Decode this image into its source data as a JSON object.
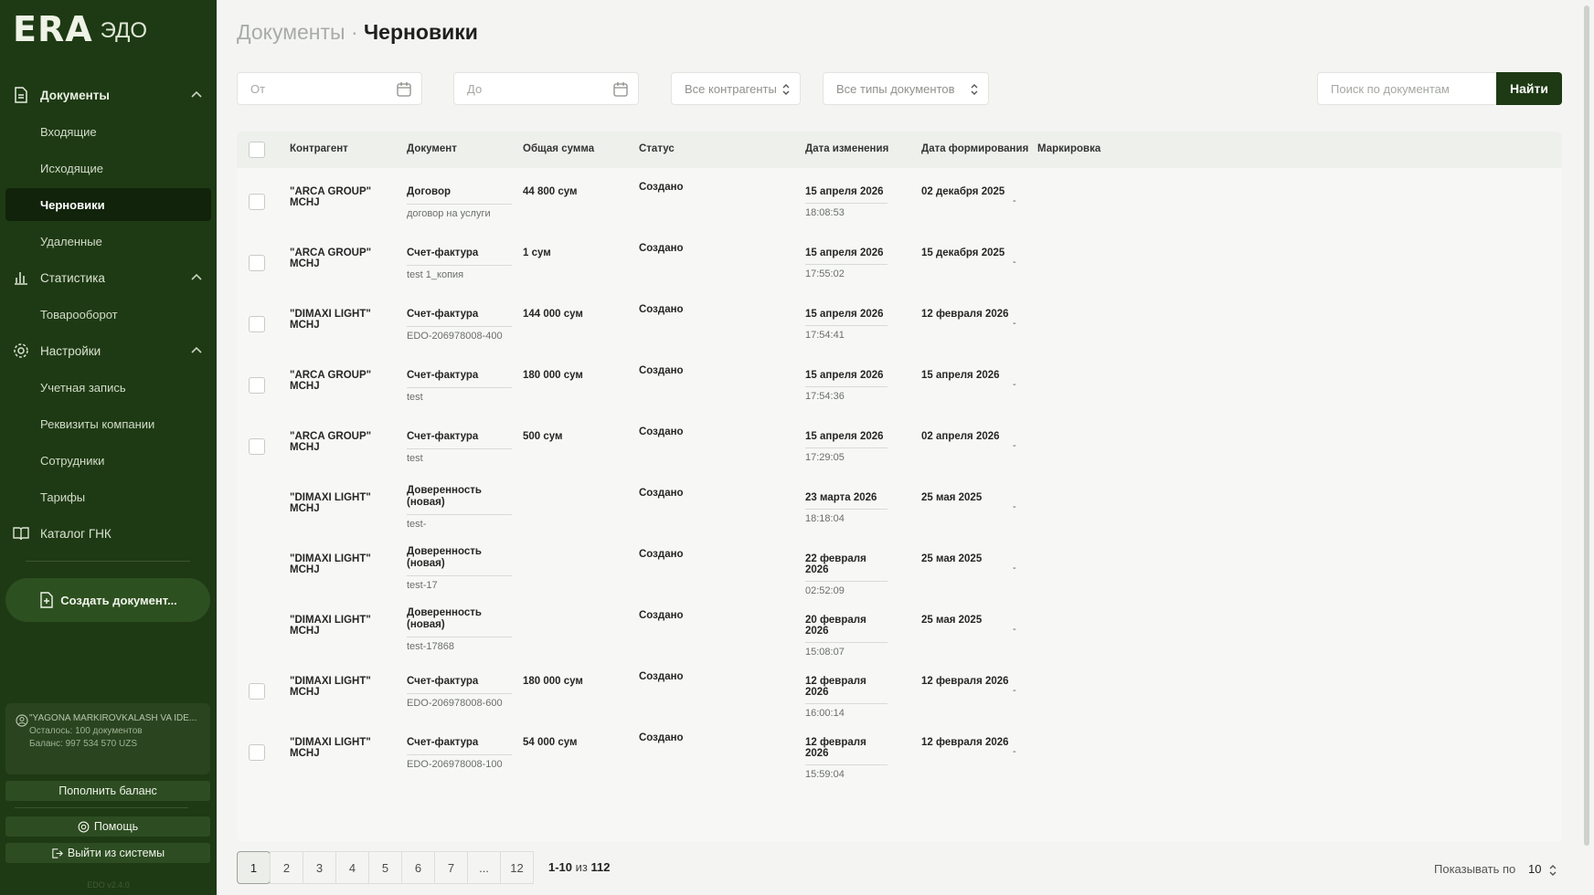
{
  "brand": {
    "logo": "ERA",
    "product": "ЭДО"
  },
  "sidebar": {
    "groups": [
      {
        "label": "Документы",
        "icon": "document-icon",
        "items": [
          "Входящие",
          "Исходящие",
          "Черновики",
          "Удаленные"
        ]
      },
      {
        "label": "Статистика",
        "icon": "bar-chart-icon",
        "items": [
          "Товарооборот"
        ]
      },
      {
        "label": "Настройки",
        "icon": "gear-icon",
        "items": [
          "Учетная запись",
          "Реквизиты компании",
          "Сотрудники",
          "Тарифы"
        ]
      }
    ],
    "catalog": "Каталог ГНК",
    "active_item": "Черновики",
    "create_button": "Создать документ...",
    "account": {
      "company": "\"YAGONA MARKIROVKALASH VA IDE...",
      "remaining": "Осталось: 100 документов",
      "balance": "Баланс: 997 534 570 UZS"
    },
    "topup_button": "Пополнить баланс",
    "help_button": "Помощь",
    "logout_button": "Выйти из системы",
    "version": "EDO v2.4.0"
  },
  "page": {
    "section": "Документы",
    "separator": "·",
    "title": "Черновики"
  },
  "filters": {
    "from_placeholder": "От",
    "to_placeholder": "До",
    "counterparties": "Все контрагенты",
    "doc_types": "Все типы документов",
    "search_placeholder": "Поиск по документам",
    "search_button": "Найти"
  },
  "table": {
    "columns": [
      "Контрагент",
      "Документ",
      "Общая сумма",
      "Статус",
      "Дата изменения",
      "Дата формирования",
      "Маркировка"
    ],
    "rows": [
      {
        "counterparty": "\"ARCA GROUP\" MCHJ",
        "doc_type": "Договор",
        "doc_name": "договор на услуги",
        "amount": "44 800 сум",
        "status": "Создано",
        "changed_date": "15 апреля 2026",
        "changed_time": "18:08:53",
        "formed": "02 декабря 2025",
        "marking": "-",
        "checkbox": true
      },
      {
        "counterparty": "\"ARCA GROUP\" MCHJ",
        "doc_type": "Счет-фактура",
        "doc_name": "test 1_копия",
        "amount": "1 сум",
        "status": "Создано",
        "changed_date": "15 апреля 2026",
        "changed_time": "17:55:02",
        "formed": "15 декабря 2025",
        "marking": "-",
        "checkbox": true
      },
      {
        "counterparty": "\"DIMAXI LIGHT\" MCHJ",
        "doc_type": "Счет-фактура",
        "doc_name": "EDO-206978008-400",
        "amount": "144 000 сум",
        "status": "Создано",
        "changed_date": "15 апреля 2026",
        "changed_time": "17:54:41",
        "formed": "12 февраля 2026",
        "marking": "-",
        "checkbox": true
      },
      {
        "counterparty": "\"ARCA GROUP\" MCHJ",
        "doc_type": "Счет-фактура",
        "doc_name": "test",
        "amount": "180 000 сум",
        "status": "Создано",
        "changed_date": "15 апреля 2026",
        "changed_time": "17:54:36",
        "formed": "15 апреля 2026",
        "marking": "-",
        "checkbox": true
      },
      {
        "counterparty": "\"ARCA GROUP\" MCHJ",
        "doc_type": "Счет-фактура",
        "doc_name": "test",
        "amount": "500 сум",
        "status": "Создано",
        "changed_date": "15 апреля 2026",
        "changed_time": "17:29:05",
        "formed": "02 апреля 2026",
        "marking": "-",
        "checkbox": true
      },
      {
        "counterparty": "\"DIMAXI LIGHT\" MCHJ",
        "doc_type": "Доверенность (новая)",
        "doc_name": "test-",
        "amount": "",
        "status": "Создано",
        "changed_date": "23 марта 2026",
        "changed_time": "18:18:04",
        "formed": "25 мая 2025",
        "marking": "-",
        "checkbox": false
      },
      {
        "counterparty": "\"DIMAXI LIGHT\" MCHJ",
        "doc_type": "Доверенность (новая)",
        "doc_name": "test-17",
        "amount": "",
        "status": "Создано",
        "changed_date": "22 февраля 2026",
        "changed_time": "02:52:09",
        "formed": "25 мая 2025",
        "marking": "-",
        "checkbox": false
      },
      {
        "counterparty": "\"DIMAXI LIGHT\" MCHJ",
        "doc_type": "Доверенность (новая)",
        "doc_name": "test-17868",
        "amount": "",
        "status": "Создано",
        "changed_date": "20 февраля 2026",
        "changed_time": "15:08:07",
        "formed": "25 мая 2025",
        "marking": "-",
        "checkbox": false
      },
      {
        "counterparty": "\"DIMAXI LIGHT\" MCHJ",
        "doc_type": "Счет-фактура",
        "doc_name": "EDO-206978008-600",
        "amount": "180 000 сум",
        "status": "Создано",
        "changed_date": "12 февраля 2026",
        "changed_time": "16:00:14",
        "formed": "12 февраля 2026",
        "marking": "-",
        "checkbox": true
      },
      {
        "counterparty": "\"DIMAXI LIGHT\" MCHJ",
        "doc_type": "Счет-фактура",
        "doc_name": "EDO-206978008-100",
        "amount": "54 000 сум",
        "status": "Создано",
        "changed_date": "12 февраля 2026",
        "changed_time": "15:59:04",
        "formed": "12 февраля 2026",
        "marking": "-",
        "checkbox": true
      }
    ]
  },
  "pagination": {
    "pages": [
      "1",
      "2",
      "3",
      "4",
      "5",
      "6",
      "7",
      "...",
      "12"
    ],
    "current": "1",
    "range": "1-10",
    "of_word": "из",
    "total": "112",
    "per_page_label": "Показывать по",
    "per_page_value": "10"
  },
  "colors": {
    "sidebar_bg": "#1e3a14",
    "accent": "#1e3a14",
    "page_bg": "#f4f5f3"
  }
}
